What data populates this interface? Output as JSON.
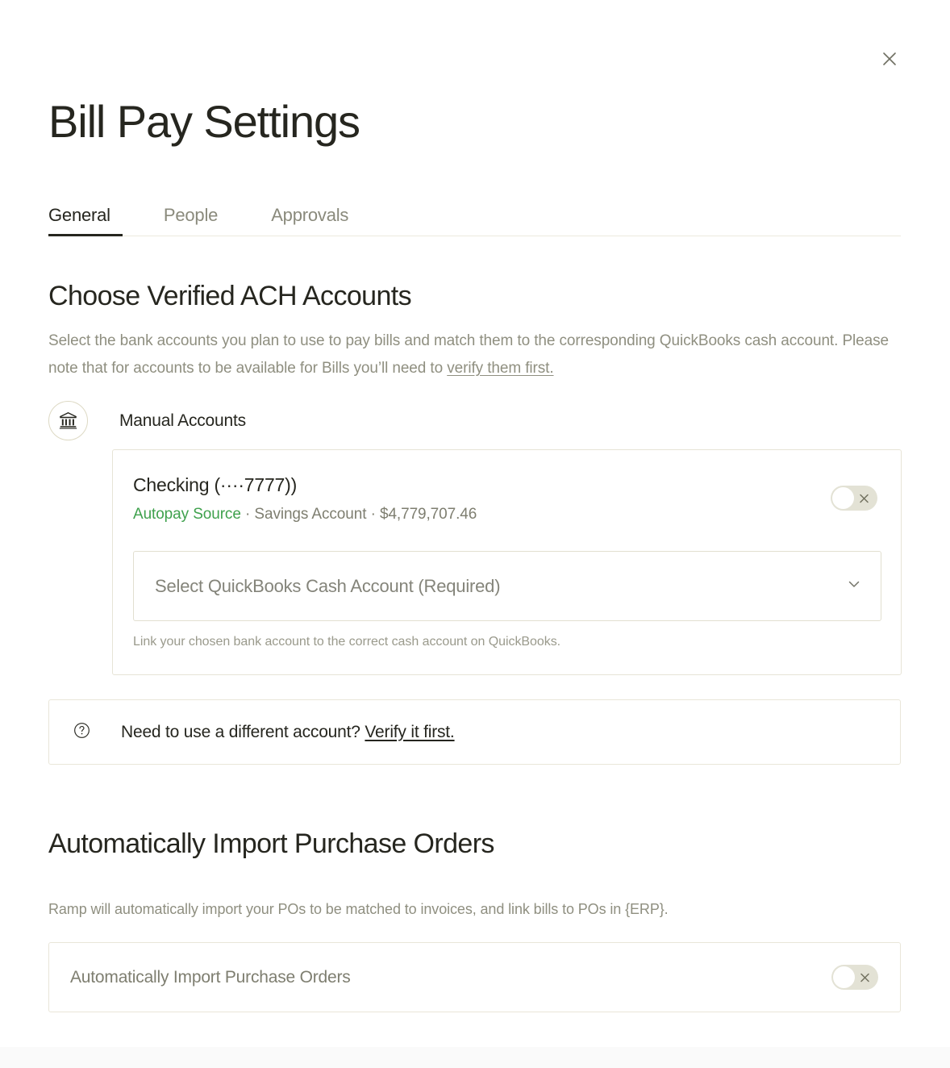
{
  "window": {
    "title": "Bill Pay Settings",
    "close_icon": "close-icon"
  },
  "tabs": [
    {
      "label": "General",
      "active": true
    },
    {
      "label": "People",
      "active": false
    },
    {
      "label": "Approvals",
      "active": false
    }
  ],
  "sections": {
    "ach": {
      "heading": "Choose Verified ACH Accounts",
      "description_part1": "Select the bank accounts you plan to use to pay bills and match them to the corresponding QuickBooks cash account. Please note that for accounts to be available for Bills you’ll need to ",
      "description_link": "verify them first.",
      "group": {
        "icon": "bank-icon",
        "label": "Manual Accounts"
      },
      "account": {
        "name": "Checking (····7777))",
        "badge": "Autopay Source",
        "separator1": " · ",
        "type": "Savings Account",
        "separator2": " · ",
        "balance": "$4,779,707.46",
        "toggle_state": "off",
        "toggle_mark": "close-icon",
        "select_placeholder": "Select QuickBooks Cash Account (Required)",
        "select_chevron": "chevron-down-icon",
        "select_help": "Link your chosen bank account to the correct cash account on QuickBooks."
      },
      "verify_banner": {
        "icon": "question-circle-icon",
        "text": "Need to use a different account? ",
        "link": "Verify it first."
      }
    },
    "purchase_orders": {
      "heading": "Automatically Import Purchase Orders",
      "description": "Ramp will automatically import your POs to be matched to invoices, and link bills to POs in {ERP}.",
      "row_label": "Automatically Import Purchase Orders",
      "toggle_state": "off",
      "toggle_mark": "close-icon"
    }
  },
  "colors": {
    "accent_green": "#3fa14d",
    "text_primary": "#26261f",
    "text_muted": "#8f8f80",
    "border": "#e7e4d6",
    "toggle_off_track": "#e3e2d5"
  }
}
